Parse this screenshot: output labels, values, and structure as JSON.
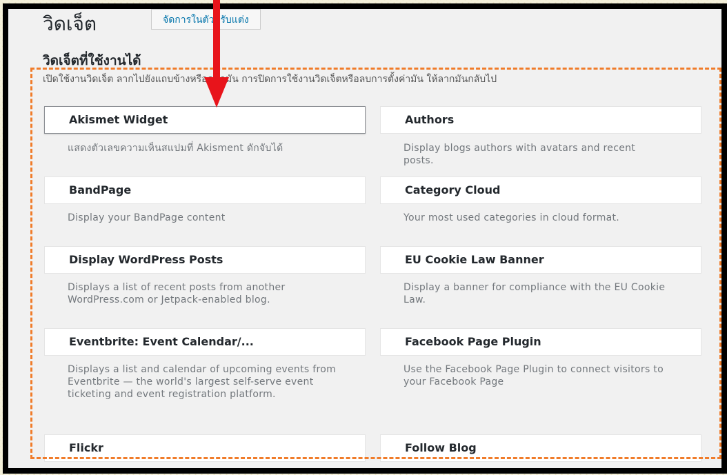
{
  "header": {
    "title": "วิดเจ็ต",
    "manage_label": "จัดการในตัวปรับแต่ง"
  },
  "available": {
    "heading": "วิดเจ็ตที่ใช้งานได้",
    "intro": "เปิดใช้งานวิดเจ็ต ลากไปยังแถบข้างหรือคลิกมัน การปิดการใช้งานวิดเจ็ตหรือลบการตั้งค่ามัน ให้ลากมันกลับไป"
  },
  "widgets": [
    {
      "title": "Akismet Widget",
      "desc": "แสดงตัวเลขความเห็นสแปมที่ Akisment ดักจับได้"
    },
    {
      "title": "Authors",
      "desc": "Display blogs authors with avatars and recent posts."
    },
    {
      "title": "BandPage",
      "desc": "Display your BandPage content"
    },
    {
      "title": "Category Cloud",
      "desc": "Your most used categories in cloud format."
    },
    {
      "title": "Display WordPress Posts",
      "desc": "Displays a list of recent posts from another WordPress.com or Jetpack-enabled blog."
    },
    {
      "title": "EU Cookie Law Banner",
      "desc": "Display a banner for compliance with the EU Cookie Law."
    },
    {
      "title": "Eventbrite: Event Calendar/...",
      "desc": "Displays a list and calendar of upcoming events from Eventbrite — the world's largest self-serve event ticketing and event registration platform."
    },
    {
      "title": "Facebook Page Plugin",
      "desc": "Use the Facebook Page Plugin to connect visitors to your Facebook Page"
    },
    {
      "title": "Flickr",
      "desc": ""
    },
    {
      "title": "Follow Blog",
      "desc": ""
    }
  ],
  "colors": {
    "highlight_border": "#f07c2a",
    "arrow": "#e8141b",
    "link": "#0073aa"
  },
  "icons": [
    "red-down-arrow"
  ]
}
